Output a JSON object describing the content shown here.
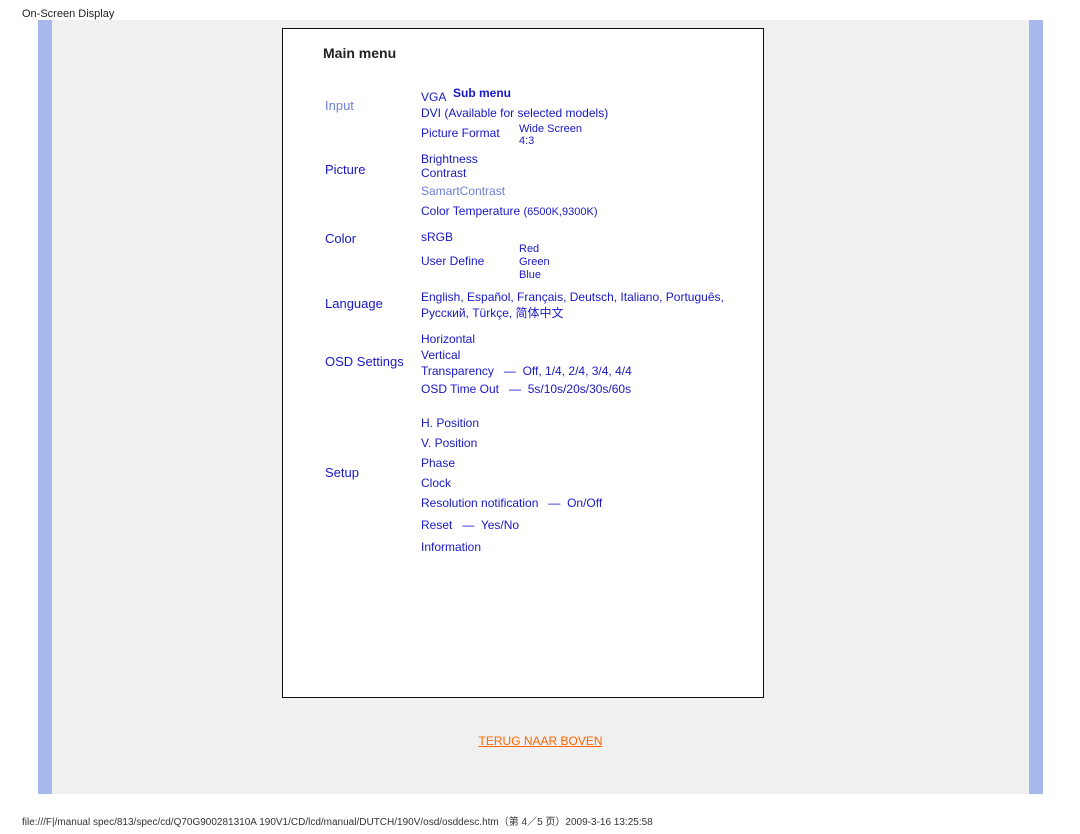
{
  "page_title": "On-Screen Display",
  "headers": {
    "main": "Main menu",
    "sub": "Sub menu"
  },
  "main_items": {
    "input": "Input",
    "picture": "Picture",
    "color": "Color",
    "language": "Language",
    "osd": "OSD Settings",
    "setup": "Setup"
  },
  "sub_items": {
    "vga": "VGA",
    "dvi": "DVI (Available for selected models)",
    "picture_format": "Picture Format",
    "wide": "Wide Screen",
    "ratio": "4:3",
    "brightness": "Brightness",
    "contrast": "Contrast",
    "smart": "SamartContrast",
    "colortemp": "Color Temperature",
    "colortemp_vals": "(6500K,9300K)",
    "srgb": "sRGB",
    "userdef": "User Define",
    "red": "Red",
    "green": "Green",
    "blue": "Blue",
    "languages": "English, Español, Français, Deutsch, Italiano, Português, Русский, Türkçe, 简体中文",
    "horiz": "Horizontal",
    "vert": "Vertical",
    "transp": "Transparency",
    "transp_vals": "Off, 1/4, 2/4, 3/4, 4/4",
    "timeout": "OSD Time Out",
    "timeout_vals": "5s/10s/20s/30s/60s",
    "hpos": "H. Position",
    "vpos": "V. Position",
    "phase": "Phase",
    "clock": "Clock",
    "resnotif": "Resolution notification",
    "resnotif_vals": "On/Off",
    "reset": "Reset",
    "reset_vals": "Yes/No",
    "info": "Information"
  },
  "back_link": "TERUG NAAR BOVEN",
  "footer": "file:///F|/manual spec/813/spec/cd/Q70G900281310A 190V1/CD/lcd/manual/DUTCH/190V/osd/osddesc.htm（第 4／5 页）2009-3-16 13:25:58"
}
